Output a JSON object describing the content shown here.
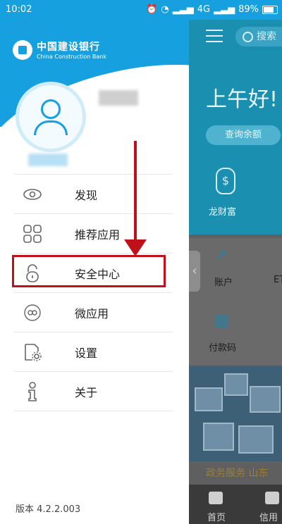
{
  "status_bar": {
    "time": "10:02",
    "network": "4G",
    "battery": "89%"
  },
  "bank_logo": {
    "name_cn": "中国建设银行",
    "name_en": "China Construction Bank"
  },
  "menu": [
    {
      "label": "发现",
      "icon": "eye-icon"
    },
    {
      "label": "推荐应用",
      "icon": "grid-icon"
    },
    {
      "label": "安全中心",
      "icon": "lock-icon"
    },
    {
      "label": "微应用",
      "icon": "infinity-icon"
    },
    {
      "label": "设置",
      "icon": "gear-icon"
    },
    {
      "label": "关于",
      "icon": "info-icon"
    }
  ],
  "version_text": "版本 4.2.2.003",
  "background_app": {
    "search_placeholder": "搜索",
    "greeting": "上午好!",
    "balance_button": "查询余额",
    "fortune_label": "龙财富",
    "account_label": "账户",
    "et_label": "ET",
    "payment_code_label": "付款码",
    "news_text": "政务服务 山东",
    "tab_home": "首页",
    "tab_credit": "信用卡"
  },
  "colors": {
    "brand_blue": "#16a0e0",
    "highlight_red": "#c0111b"
  }
}
